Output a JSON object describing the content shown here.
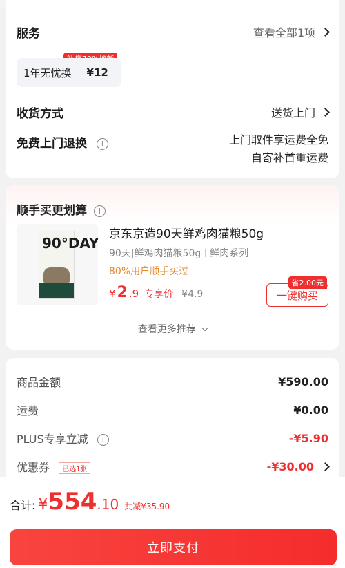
{
  "service": {
    "title": "服务",
    "view_all": "查看全部1项",
    "chip_tag": "补您70%换新",
    "chip_name": "1年无忧换",
    "chip_price": "¥12"
  },
  "delivery": {
    "title": "收货方式",
    "value": "送货上门"
  },
  "return": {
    "title": "免费上门退换",
    "info_icon": "i",
    "line1": "上门取件享运费全免",
    "line2": "自寄补首重运费"
  },
  "recommend": {
    "title": "顺手买更划算",
    "info_icon": "i",
    "image_text": "90°DAY",
    "product_name": "京东京造90天鲜鸡肉猫粮50g",
    "sub1": "90天|鲜鸡肉猫粮50g",
    "sub2": "鲜肉系列",
    "hot": "80%用户顺手买过",
    "price_cur": "¥",
    "price_int": "2",
    "price_dec": ".9",
    "price_label": "专享价",
    "orig_price": "¥4.9",
    "save_tag": "省2.00元",
    "buy_label": "一键购买",
    "more": "查看更多推荐"
  },
  "amounts": {
    "goods_label": "商品金额",
    "goods_value": "¥590.00",
    "shipping_label": "运费",
    "shipping_value": "¥0.00",
    "plus_label": "PLUS专享立减",
    "plus_info_icon": "i",
    "plus_value": "-¥5.90",
    "coupon_label": "优惠券",
    "coupon_tag": "已选1张",
    "coupon_value": "-¥30.00"
  },
  "footer": {
    "total_label": "合计:",
    "total_cur": "¥",
    "total_int": "554",
    "total_dec": ".10",
    "saved": "共减¥35.90",
    "pay_label": "立即支付"
  },
  "colors": {
    "accent": "#ee2f2f",
    "hot": "#e8892c"
  }
}
